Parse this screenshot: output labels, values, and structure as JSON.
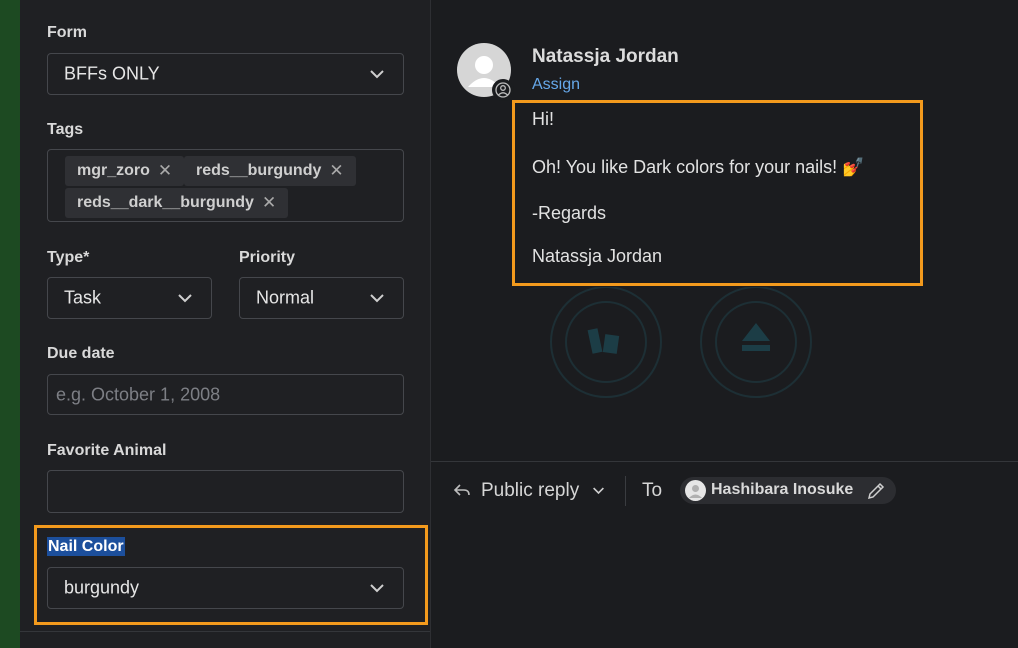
{
  "form": {
    "label": "Form",
    "value": "BFFs ONLY"
  },
  "tags": {
    "label": "Tags",
    "items": [
      "mgr_zoro",
      "reds__burgundy",
      "reds__dark__burgundy"
    ],
    "remove_glyph": "✕"
  },
  "type": {
    "label": "Type*",
    "value": "Task"
  },
  "priority": {
    "label": "Priority",
    "value": "Normal"
  },
  "due_date": {
    "label": "Due date",
    "placeholder": "e.g. October 1, 2008"
  },
  "favorite_animal": {
    "label": "Favorite Animal",
    "value": ""
  },
  "nail_color": {
    "label": "Nail Color",
    "value": "burgundy"
  },
  "message": {
    "author": "Natassja Jordan",
    "assign_label": "Assign",
    "lines": [
      "Hi!",
      "Oh! You like Dark colors for your nails! 💅",
      "-Regards",
      "Natassja Jordan"
    ]
  },
  "reply": {
    "mode_label": "Public reply",
    "to_label": "To",
    "recipient": "Hashibara Inosuke"
  },
  "colors": {
    "highlight": "#f39a1d",
    "link": "#66a8ea",
    "selection": "#1c4f9c",
    "side_strip": "#1d4a22"
  },
  "icons": [
    "chevron-down-icon",
    "close-icon",
    "avatar-icon",
    "user-badge-icon",
    "reply-arrow-icon",
    "pencil-icon",
    "certification-badge-icon"
  ]
}
